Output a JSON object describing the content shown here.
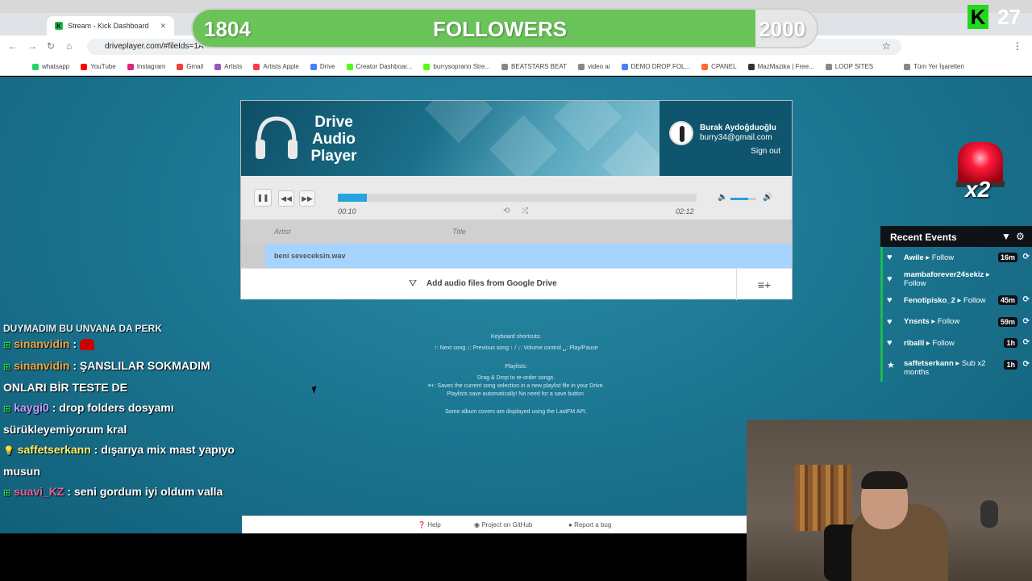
{
  "browser": {
    "tab": {
      "title": "Stream - Kick Dashboard"
    },
    "url": "driveplayer.com/#fileIds=1A",
    "bookmarks": [
      "whatsapp",
      "YouTube",
      "Instagram",
      "Gmail",
      "Artists",
      "Artists Apple",
      "Drive",
      "Creator Dashboar...",
      "burrysoprano Stre...",
      "BEATSTARS BEAT",
      "video ai",
      "DEMO DROP FOL...",
      "CPANEL",
      "MazMazika | Free...",
      "LOOP SITES"
    ],
    "all_bookmarks": "Tüm Yer İşaretleri"
  },
  "overlay": {
    "followers_current": "1804",
    "followers_label": "FOLLOWERS",
    "followers_goal": "2000",
    "followers_progress": 0.902,
    "kick_count": "27",
    "multiplier": "x2"
  },
  "player": {
    "app_name": "Drive Audio Player",
    "user_name": "Burak Aydoğduoğlu",
    "user_email": "burry34@gmail.com",
    "sign_out": "Sign out",
    "time_current": "00:10",
    "time_total": "02:12",
    "progress": 0.08,
    "volume": 0.7,
    "col_artist": "Artist",
    "col_title": "Title",
    "song": "beni seveceksin.wav",
    "add_files": "Add audio files from Google Drive"
  },
  "help": {
    "shortcuts_title": "Keyboard shortcuts:",
    "shortcuts": "↑: Next song  ↓: Previous song  ↑ / ↓: Volume control  ␣: Play/Pause",
    "playlists_title": "Playlists:",
    "playlists_1": "Drag & Drop to re-order songs.",
    "playlists_2": "≡+: Saves the current song selection in a new playlist file in your Drive.",
    "playlists_3": "Playlists save automatically! No need for a save button.",
    "album": "Some album covers are displayed using the LastFM API."
  },
  "footer": {
    "help": "Help",
    "github": "Project on GitHub",
    "bug": "Report a bug"
  },
  "events": {
    "title": "Recent Events",
    "items": [
      {
        "user": "Awile",
        "action": "Follow",
        "time": "16m",
        "icon": "heart-icon"
      },
      {
        "user": "mambaforever24sekiz",
        "action": "Follow",
        "time": "",
        "icon": "heart-icon"
      },
      {
        "user": "Fenotipisko_2",
        "action": "Follow",
        "time": "45m",
        "icon": "heart-icon"
      },
      {
        "user": "Ynsnts",
        "action": "Follow",
        "time": "59m",
        "icon": "heart-icon"
      },
      {
        "user": "riballl",
        "action": "Follow",
        "time": "1h",
        "icon": "heart-icon"
      },
      {
        "user": "saffetserkann",
        "action": "Sub x2 months",
        "time": "1h",
        "icon": "star-icon"
      }
    ]
  },
  "chat": {
    "partial": "DUYMADIM BU UNVANA DA PERK",
    "messages": [
      {
        "user": "sinanvidin",
        "color": "#f0a340",
        "text": ""
      },
      {
        "user": "sinanvidin",
        "color": "#f0a340",
        "text": "ŞANSLILAR SOKMADIM ONLARI BİR TESTE DE"
      },
      {
        "user": "kaygi0",
        "color": "#c79bff",
        "text": "drop folders dosyamı sürükleyemiyorum kral"
      },
      {
        "user": "saffetserkann",
        "color": "#ffef6b",
        "text": "dışarıya mix mast yapıyo musun"
      },
      {
        "user": "suavi_KZ",
        "color": "#e0679c",
        "text": "seni gordum iyi oldum valla"
      }
    ]
  },
  "colors": {
    "accent": "#27a2dc",
    "kick_green": "#22d91e",
    "page_bg": "#1c7792"
  }
}
